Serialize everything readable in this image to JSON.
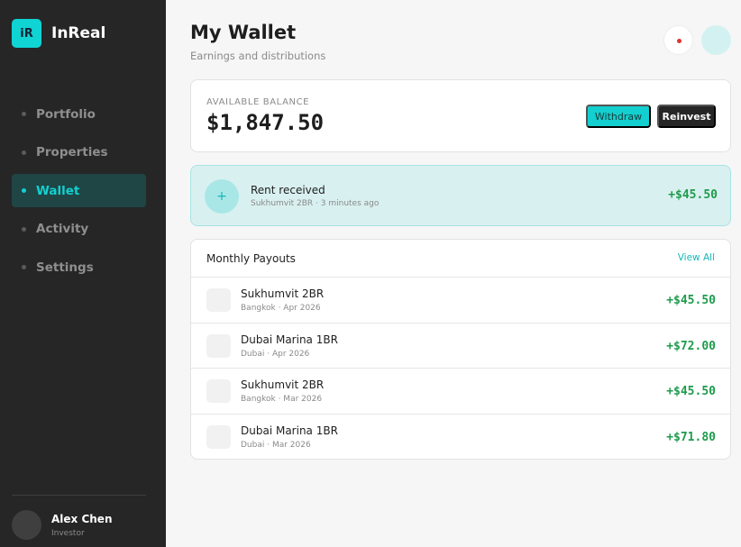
{
  "brand": {
    "logo_text": "iR",
    "name": "InReal"
  },
  "nav": {
    "items": [
      {
        "label": "Portfolio",
        "active": false
      },
      {
        "label": "Properties",
        "active": false
      },
      {
        "label": "Wallet",
        "active": true
      },
      {
        "label": "Activity",
        "active": false
      },
      {
        "label": "Settings",
        "active": false
      }
    ]
  },
  "user": {
    "name": "Alex Chen",
    "role": "Investor"
  },
  "header": {
    "title": "My Wallet",
    "subtitle": "Earnings and distributions"
  },
  "balance": {
    "label": "AVAILABLE BALANCE",
    "value": "$1,847.50",
    "withdraw_label": "Withdraw",
    "reinvest_label": "Reinvest"
  },
  "notification": {
    "icon": "+",
    "title": "Rent received",
    "subtitle": "Sukhumvit 2BR · 3 minutes ago",
    "amount": "+$45.50"
  },
  "payouts": {
    "title": "Monthly Payouts",
    "view_all": "View All",
    "rows": [
      {
        "name": "Sukhumvit 2BR",
        "meta": "Bangkok · Apr 2026",
        "amount": "+$45.50"
      },
      {
        "name": "Dubai Marina 1BR",
        "meta": "Dubai · Apr 2026",
        "amount": "+$72.00"
      },
      {
        "name": "Sukhumvit 2BR",
        "meta": "Bangkok · Mar 2026",
        "amount": "+$45.50"
      },
      {
        "name": "Dubai Marina 1BR",
        "meta": "Dubai · Mar 2026",
        "amount": "+$71.80"
      }
    ]
  },
  "colors": {
    "accent": "#13d0d0",
    "sidebar_bg": "#262626",
    "positive": "#1e9b4d",
    "notification_dot": "#e03333"
  }
}
